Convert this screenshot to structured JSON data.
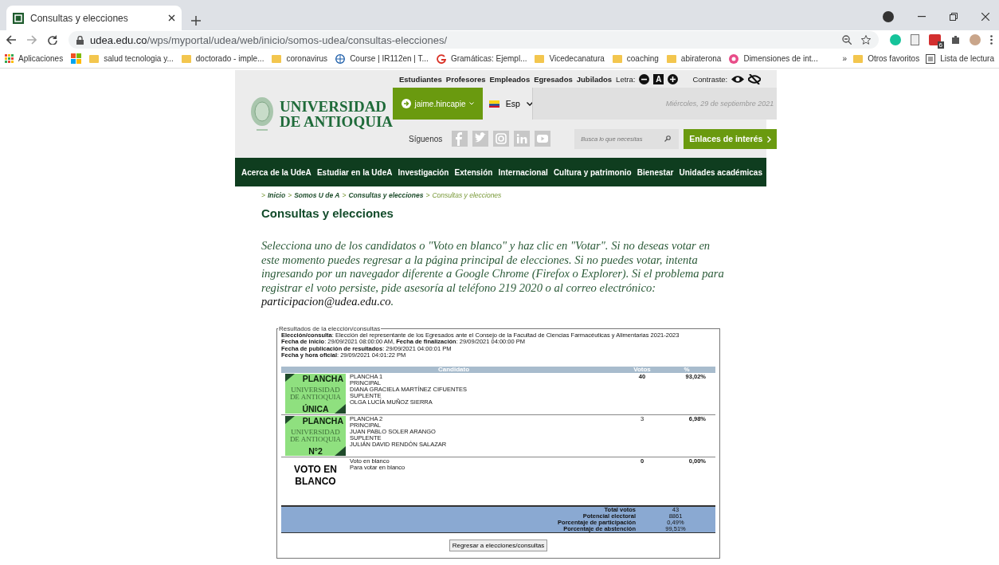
{
  "browser": {
    "tab_title": "Consultas y elecciones",
    "url_host": "udea.edu.co",
    "url_path": "/wps/myportal/udea/web/inicio/somos-udea/consultas-elecciones/",
    "bookmarks": [
      {
        "kind": "apps",
        "label": "Aplicaciones"
      },
      {
        "kind": "tiles"
      },
      {
        "kind": "folder",
        "label": "salud tecnologia y..."
      },
      {
        "kind": "folder",
        "label": "doctorado - imple..."
      },
      {
        "kind": "folder",
        "label": "coronavirus"
      },
      {
        "kind": "globe",
        "label": "Course | IR112en | T..."
      },
      {
        "kind": "g",
        "label": "Gramáticas: Ejempl..."
      },
      {
        "kind": "folder",
        "label": "Vicedecanatura"
      },
      {
        "kind": "folder",
        "label": "coaching"
      },
      {
        "kind": "folder",
        "label": "abiraterona"
      },
      {
        "kind": "circle",
        "label": "Dimensiones de int..."
      }
    ],
    "more": "»",
    "other_bookmarks": "Otros favoritos",
    "reading_list": "Lista de lectura",
    "extension_badge": "6"
  },
  "header": {
    "logo_lines": [
      "UNIVERSIDAD",
      "DE ANTIOQUIA"
    ],
    "audiences": [
      "Estudiantes",
      "Profesores",
      "Empleados",
      "Egresados",
      "Jubilados"
    ],
    "font_label": "Letra:",
    "font_key": "A",
    "contrast_label": "Contraste:",
    "user": "jaime.hincapie",
    "language": "Esp",
    "date": "Miércoles, 29 de septiembre 2021",
    "follow_label": "Síguenos",
    "search": {
      "placeholder": "Busca lo que necesitas"
    },
    "links_button": "Enlaces de interés"
  },
  "nav": [
    "Acerca de la UdeA",
    "Estudiar en la UdeA",
    "Investigación",
    "Extensión",
    "Internacional",
    "Cultura y patrimonio",
    "Bienestar",
    "Unidades académicas"
  ],
  "breadcrumb_separator": ">",
  "breadcrumb": [
    {
      "label": "Inicio",
      "current": false
    },
    {
      "label": "Somos U de A",
      "current": false
    },
    {
      "label": "Consultas y elecciones",
      "current": false
    },
    {
      "label": "Consultas y elecciones",
      "current": true
    }
  ],
  "page_title": "Consultas y elecciones",
  "intro": "Selecciona uno de los candidatos o \"Voto en blanco\" y haz clic en \"Votar\". Si no deseas votar en este momento puedes regresar a la página principal de elecciones. Si no puedes votar, intenta ingresando por un navegador diferente a Google Chrome (Firefox o Explorer). Si el problema para registrar el voto persiste, pide asesoría al teléfono 219 2020 o al correo electrónico: ",
  "intro_email": "participacion@udea.edu.co",
  "intro_end": ".",
  "results": {
    "legend": "Resultados de la elección/consultas",
    "info": [
      "**Elección/consulta**: Elección del representante de los Egresados ante el Consejo de la Facultad de Ciencias Farmacéuticas y Alimentarias 2021-2023",
      "**Fecha de inicio**: 29/09/2021 08:00:00 AM, **Fecha de finalización**: 29/09/2021 04:00:00 PM",
      "**Fecha de publicación de resultados**: 29/09/2021 04:00:01 PM",
      "**Fecha y hora oficial**: 29/09/2021 04:01:22 PM"
    ],
    "columns": [
      "Candidato",
      "Votos",
      "%"
    ],
    "rows": [
      {
        "kind": "plancha",
        "badge": [
          "PLANCHA",
          "UNIVERSIDAD",
          "DE ANTIOQUIA",
          "ÚNICA"
        ],
        "lines": [
          "PLANCHA 1",
          "PRINCIPAL",
          "DIANA GRACIELA MARTÍNEZ CIFUENTES",
          "SUPLENTE",
          "OLGA LUCÍA MUÑOZ SIERRA"
        ],
        "votes": "40",
        "percent": "93,02%"
      },
      {
        "kind": "plancha",
        "badge": [
          "PLANCHA",
          "UNIVERSIDAD",
          "DE ANTIOQUIA",
          "N°2"
        ],
        "lines": [
          "PLANCHA 2",
          "PRINCIPAL",
          "JUAN PABLO SOLER ARANGO",
          "SUPLENTE",
          "JULIÁN DAVID RENDÓN SALAZAR"
        ],
        "votes": "3",
        "percent": "6,98%"
      },
      {
        "kind": "blank",
        "badge": [
          "VOTO EN",
          "BLANCO"
        ],
        "lines": [
          "Voto en blanco",
          "Para votar en blanco"
        ],
        "votes": "0",
        "percent": "0,00%"
      }
    ],
    "summary": [
      {
        "label": "Total votos",
        "value": "43"
      },
      {
        "label": "Potencial electoral",
        "value": "8861"
      },
      {
        "label": "Porcentaje de participación",
        "value": "0,49%"
      },
      {
        "label": "Porcentaje de abstención",
        "value": "99,51%"
      }
    ],
    "back_button": "Regresar a elecciones/consultas"
  }
}
